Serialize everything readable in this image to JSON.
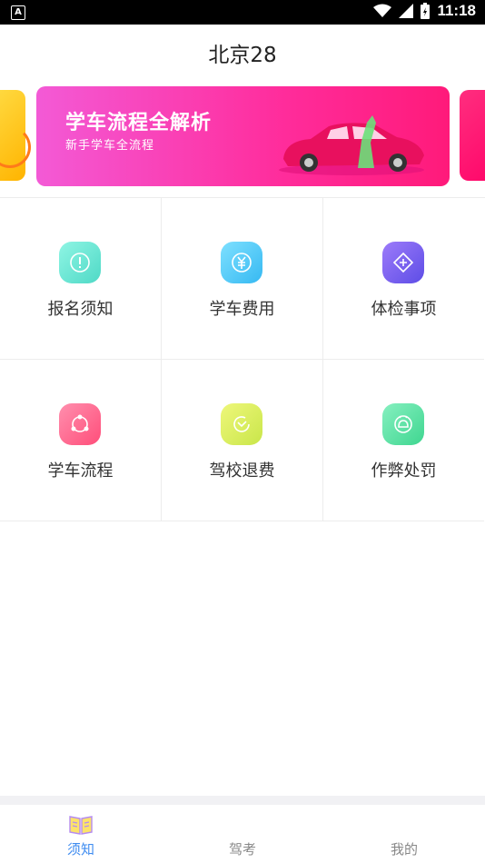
{
  "status_bar": {
    "time": "11:18",
    "left_icon": "A"
  },
  "header": {
    "title": "北京28"
  },
  "banner": {
    "title": "学车流程全解析",
    "subtitle": "新手学车全流程"
  },
  "grid": [
    {
      "label": "报名须知",
      "icon": "exclamation-icon",
      "color": "#5ee6d3"
    },
    {
      "label": "学车费用",
      "icon": "yen-icon",
      "color": "#49c6f5"
    },
    {
      "label": "体检事项",
      "icon": "diamond-plus-icon",
      "color": "#7b63f0"
    },
    {
      "label": "学车流程",
      "icon": "triangle-nodes-icon",
      "color": "#ff5b87"
    },
    {
      "label": "驾校退费",
      "icon": "refund-clock-icon",
      "color": "#d8ec5a"
    },
    {
      "label": "作弊处罚",
      "icon": "penalty-icon",
      "color": "#54e0a0"
    }
  ],
  "tabs": [
    {
      "label": "须知",
      "active": true
    },
    {
      "label": "驾考",
      "active": false
    },
    {
      "label": "我的",
      "active": false
    }
  ],
  "colors": {
    "accent": "#3f8cf0",
    "banner": "#ff2c9b"
  }
}
